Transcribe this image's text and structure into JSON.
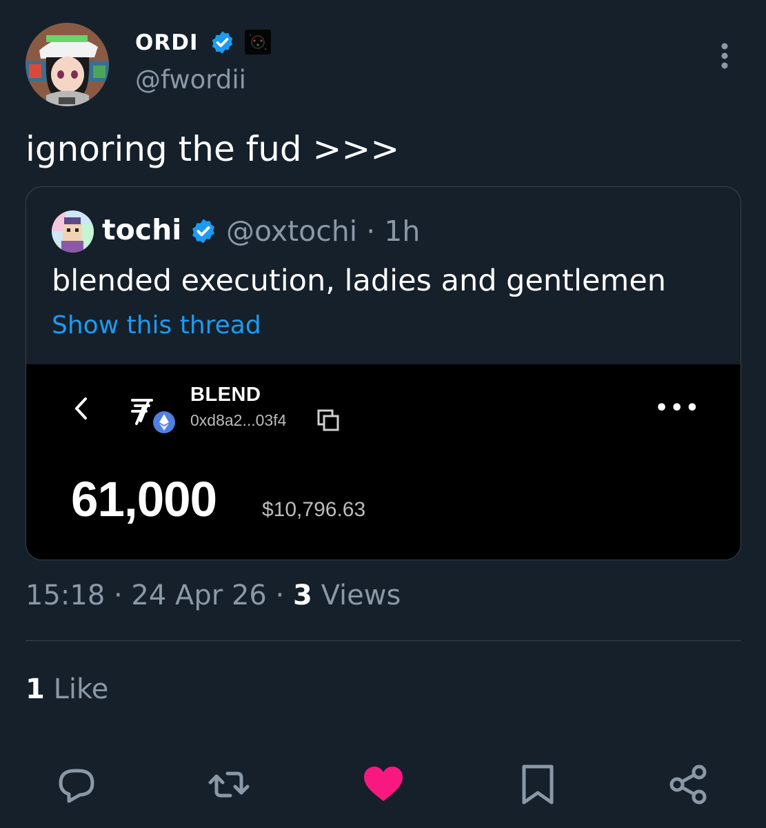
{
  "tweet": {
    "author": {
      "display_name": "ORDI",
      "handle": "@fwordii",
      "verified": true,
      "avatar_icon": "anime-avatar-icon"
    },
    "text": "ignoring the fud >>>",
    "timestamp": "15:18 · 24 Apr 26 ·",
    "views_count": "3",
    "views_label": "Views",
    "likes_count": "1",
    "likes_label": "Like"
  },
  "quote": {
    "author": {
      "display_name": "tochi",
      "handle": "@oxtochi",
      "time": "1h",
      "verified": true
    },
    "meta": "@oxtochi · 1h",
    "text": "blended execution, ladies and gentlemen",
    "show_thread": "Show this thread",
    "media": {
      "token_name": "BLEND",
      "address": "0xd8a2...03f4",
      "amount": "61,000",
      "usd_value": "$10,796.63"
    }
  },
  "actions": [
    "reply-icon",
    "retweet-icon",
    "like-icon",
    "bookmark-icon",
    "share-icon"
  ],
  "colors": {
    "background": "#15202b",
    "text_secondary": "#8b98a5",
    "link": "#1d9bf0",
    "verified": "#1d9bf0",
    "like_active": "#f91880",
    "border": "#38444d"
  }
}
